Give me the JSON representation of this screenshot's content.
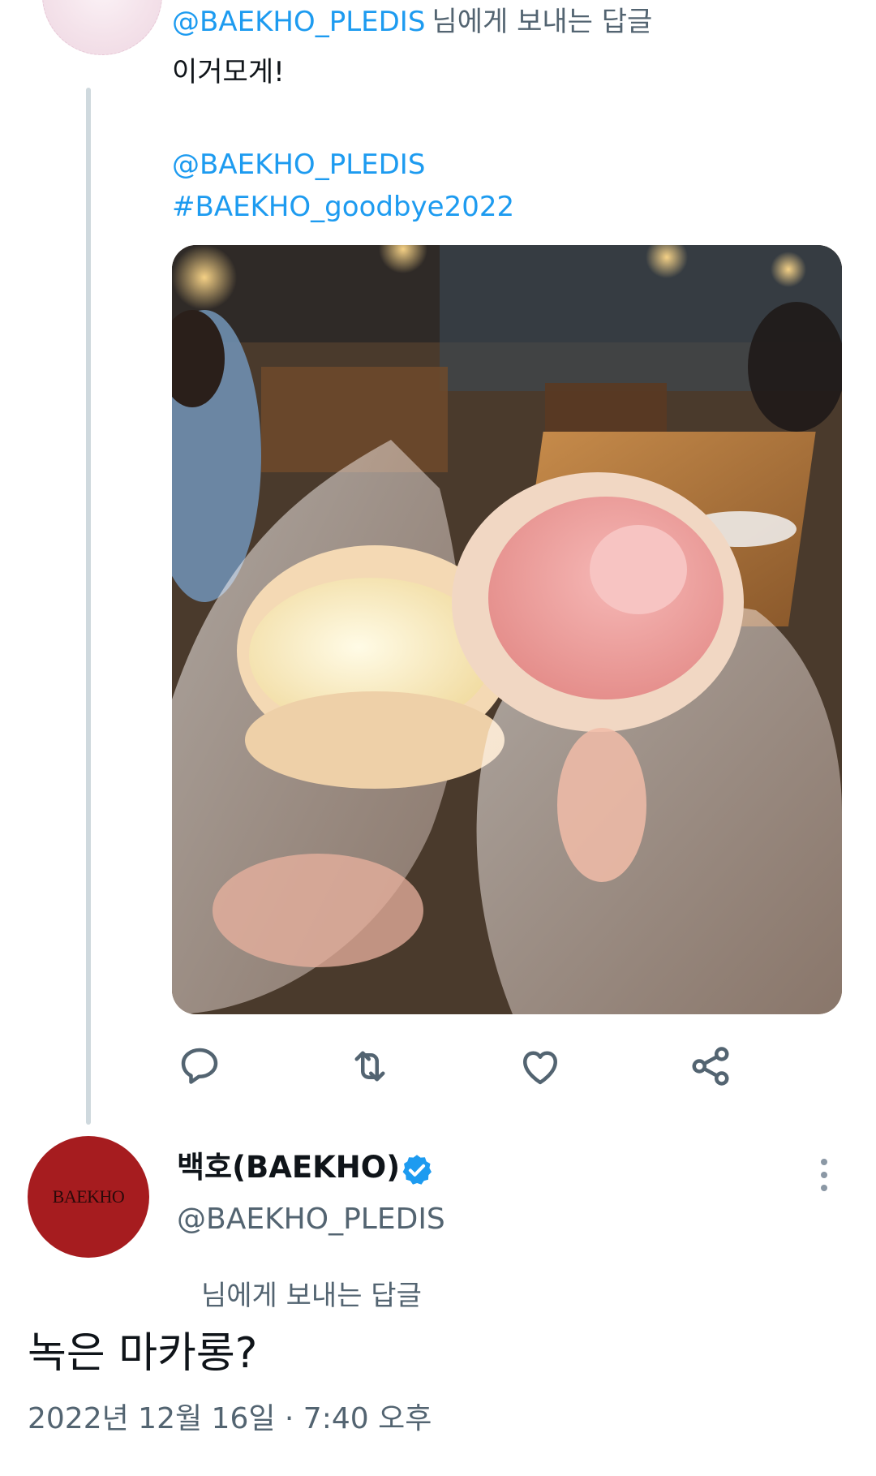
{
  "reply_tweet": {
    "reply_to_handle": "@BAEKHO_PLEDIS",
    "reply_suffix": "님에게 보내는 답글",
    "text": "이거모게!",
    "mention": "@BAEKHO_PLEDIS",
    "hashtag": "#BAEKHO_goodbye2022",
    "actions": [
      {
        "name": "reply-icon"
      },
      {
        "name": "retweet-icon"
      },
      {
        "name": "like-icon"
      },
      {
        "name": "share-icon"
      }
    ]
  },
  "main_tweet": {
    "avatar_logo_text": "BAEKHO",
    "display_name": "백호(BAEKHO)",
    "verified": true,
    "handle": "@BAEKHO_PLEDIS",
    "reply_label": "님에게 보내는 답글",
    "text": "녹은 마카롱?",
    "timestamp": "2022년 12월 16일 · 7:40 오후"
  },
  "colors": {
    "link": "#1d9bf0",
    "secondary_text": "#536471",
    "thread_line": "#cfd9de",
    "avatar_red": "#a61c1f"
  }
}
